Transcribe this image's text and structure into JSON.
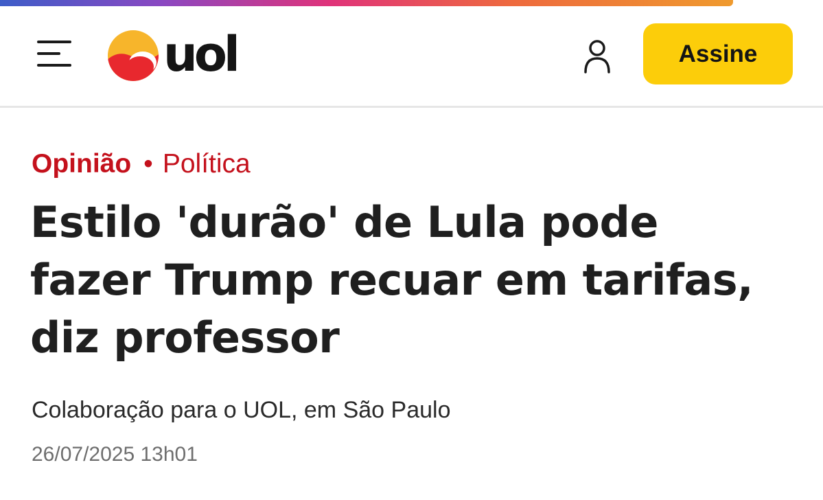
{
  "header": {
    "brand": "uol",
    "subscribe_label": "Assine",
    "icons": {
      "menu": "menu-icon",
      "logo": "uol-sun-logo-icon",
      "account": "user-icon"
    },
    "colors": {
      "subscribe_bg": "#fccd0a",
      "logo_orange": "#f7b52b",
      "logo_red": "#e8282e"
    }
  },
  "article": {
    "section": "Opinião",
    "separator": "•",
    "category": "Política",
    "headline": "Estilo 'durão' de Lula pode fazer Trump recuar em tarifas, diz professor",
    "byline": "Colaboração para o UOL, em São Paulo",
    "timestamp": "26/07/2025 13h01",
    "colors": {
      "kicker": "#c4111c",
      "headline": "#1f1f1f"
    }
  }
}
